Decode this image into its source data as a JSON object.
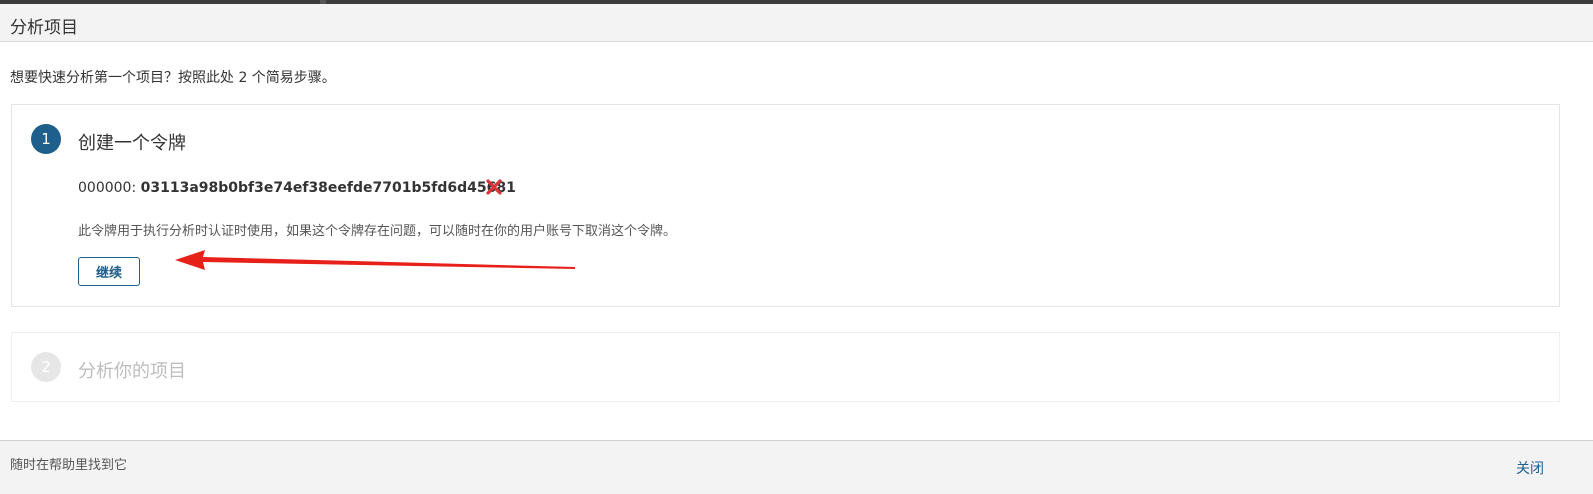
{
  "dialog": {
    "title": "分析项目",
    "intro": "想要快速分析第一个项目？按照此处 2 个简易步骤。"
  },
  "steps": [
    {
      "number": "1",
      "title": "创建一个令牌",
      "token_label": "000000: ",
      "token_value": "03113a98b0bf3e74ef38eefde7701b5fd6d45681",
      "description": "此令牌用于执行分析时认证时使用，如果这个令牌存在问题，可以随时在你的用户账号下取消这个令牌。",
      "continue_label": "继续",
      "delete_icon": "close-x-icon",
      "state": "active"
    },
    {
      "number": "2",
      "title": "分析你的项目",
      "state": "disabled"
    }
  ],
  "footer": {
    "help_text": "随时在帮助里找到它",
    "close_label": "关闭"
  },
  "colors": {
    "accent": "#1e5f8c",
    "delete": "#d63638",
    "annotation_arrow": "#e8201a",
    "disabled_text": "#bdbdbd"
  }
}
